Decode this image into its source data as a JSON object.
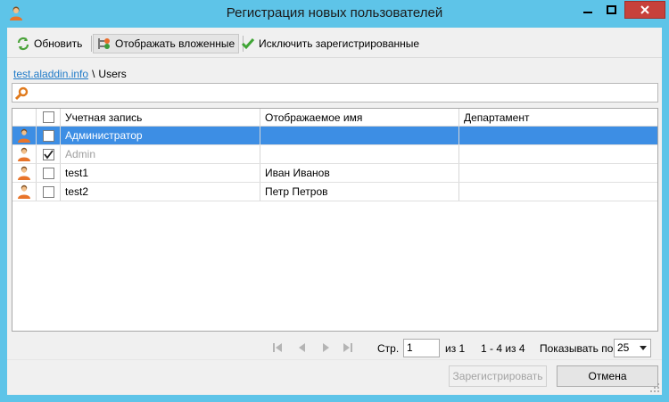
{
  "window": {
    "title": "Регистрация новых пользователей",
    "controls": [
      "minimize-icon",
      "maximize-icon",
      "close-icon"
    ]
  },
  "toolbar": {
    "refresh_label": "Обновить",
    "refresh_icon": "refresh-icon",
    "nested_label": "Отображать вложенные",
    "nested_icon": "nested-groups-icon",
    "exclude_label": "Исключить зарегистрированные",
    "exclude_icon": "checkmark-icon"
  },
  "breadcrumb": {
    "domain": "test.aladdin.info",
    "separator": "\\",
    "container": "Users"
  },
  "search": {
    "value": "",
    "icon": "search-icon"
  },
  "grid": {
    "columns": {
      "account": "Учетная запись",
      "display_name": "Отображаемое имя",
      "department": "Департамент"
    },
    "header_checked": false,
    "rows": [
      {
        "account": "Администратор",
        "display_name": "",
        "department": "",
        "checked": false,
        "selected": true,
        "disabled": false
      },
      {
        "account": "Admin",
        "display_name": "",
        "department": "",
        "checked": true,
        "selected": false,
        "disabled": true
      },
      {
        "account": "test1",
        "display_name": "Иван Иванов",
        "department": "",
        "checked": false,
        "selected": false,
        "disabled": false
      },
      {
        "account": "test2",
        "display_name": "Петр Петров",
        "department": "",
        "checked": false,
        "selected": false,
        "disabled": false
      }
    ]
  },
  "pager": {
    "page_label": "Стр.",
    "page_value": "1",
    "of_label": "из 1",
    "range_label": "1 - 4 из 4",
    "show_label": "Показывать по",
    "page_size": "25"
  },
  "buttons": {
    "register": "Зарегистрировать",
    "cancel": "Отмена"
  },
  "colors": {
    "frame": "#5ec4e8",
    "selection": "#3d8ee4",
    "close": "#c7413b",
    "link": "#1f7ac8"
  }
}
